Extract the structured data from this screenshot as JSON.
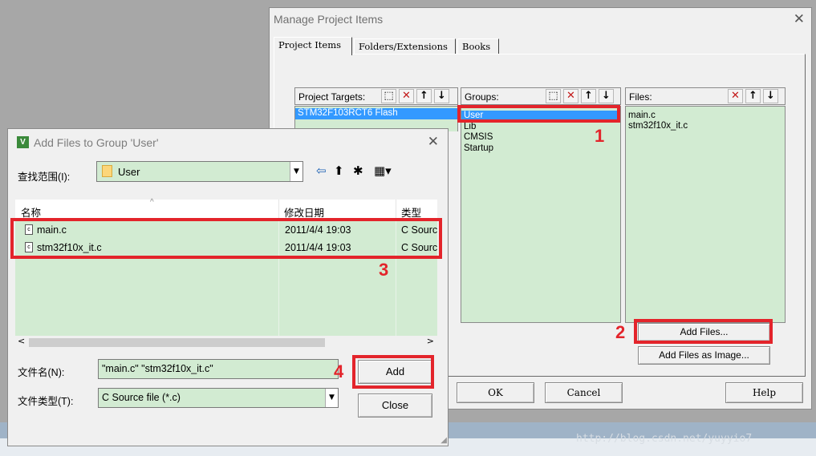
{
  "manage_dialog": {
    "title": "Manage Project Items",
    "tabs": [
      "Project Items",
      "Folders/Extensions",
      "Books"
    ],
    "targets": {
      "label": "Project Targets:",
      "items": [
        "STM32F103RCT6 Flash"
      ]
    },
    "groups": {
      "label": "Groups:",
      "items": [
        "User",
        "Lib",
        "CMSIS",
        "Startup"
      ]
    },
    "files": {
      "label": "Files:",
      "items": [
        "main.c",
        "stm32f10x_it.c"
      ]
    },
    "add_files_label": "Add Files...",
    "add_image_label": "Add Files as Image...",
    "ok_label": "OK",
    "cancel_label": "Cancel",
    "help_label": "Help"
  },
  "add_dialog": {
    "title": "Add Files to Group 'User'",
    "look_in_label": "查找范围(I):",
    "look_in_value": "User",
    "columns": [
      "名称",
      "修改日期",
      "类型"
    ],
    "files": [
      {
        "name": "main.c",
        "date": "2011/4/4 19:03",
        "type": "C Sourc"
      },
      {
        "name": "stm32f10x_it.c",
        "date": "2011/4/4 19:03",
        "type": "C Sourc"
      }
    ],
    "filename_label": "文件名(N):",
    "filename_value": "\"main.c\" \"stm32f10x_it.c\"",
    "filetype_label": "文件类型(T):",
    "filetype_value": "C Source file (*.c)",
    "add_label": "Add",
    "close_label": "Close"
  },
  "annotations": [
    "1",
    "2",
    "3",
    "4"
  ],
  "watermark": "http://blog.csdn.net/yuyyio7",
  "colors": {
    "highlight": "#e3242b",
    "list_bg": "#d2ebd2",
    "selection": "#3399ff"
  }
}
